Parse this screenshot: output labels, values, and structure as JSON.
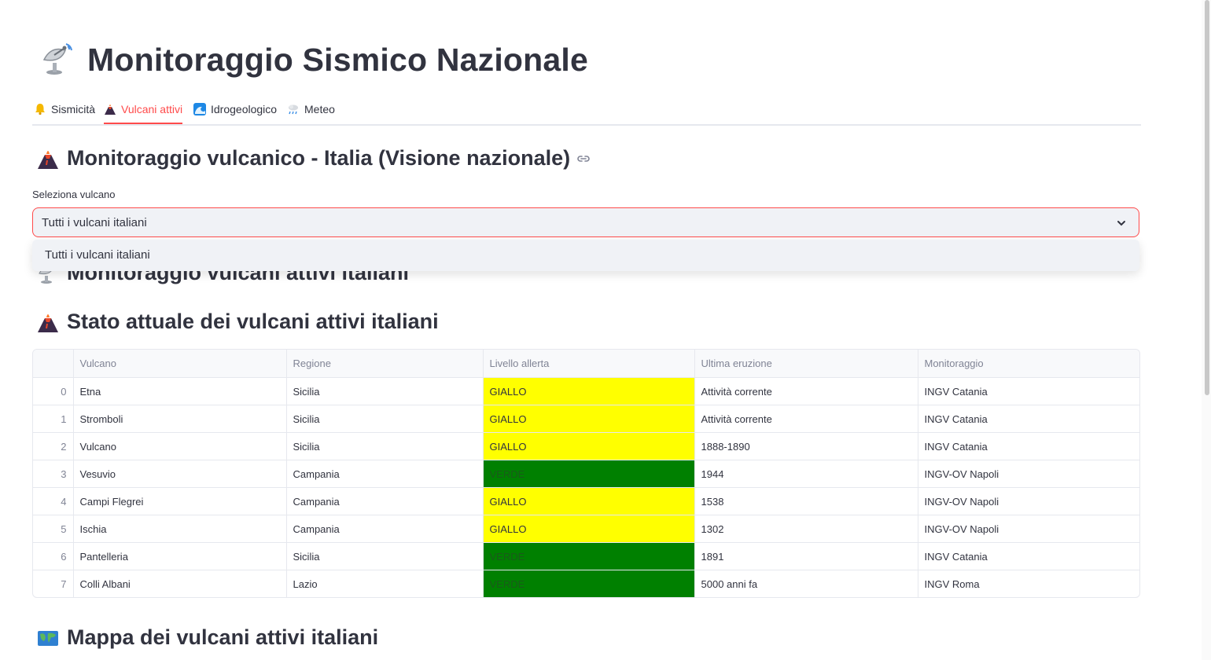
{
  "page": {
    "title": "Monitoraggio Sismico Nazionale",
    "title_icon": "satellite-antenna-icon"
  },
  "tabs": [
    {
      "label": "Sismicità",
      "icon": "bell-icon",
      "active": false
    },
    {
      "label": "Vulcani attivi",
      "icon": "volcano-icon",
      "active": true
    },
    {
      "label": "Idrogeologico",
      "icon": "water-wave-icon",
      "active": false
    },
    {
      "label": "Meteo",
      "icon": "rain-cloud-icon",
      "active": false
    }
  ],
  "section_main": {
    "title": "Monitoraggio vulcanico - Italia (Visione nazionale)",
    "icon": "volcano-icon",
    "link_icon": "link-icon"
  },
  "select": {
    "label": "Seleziona vulcano",
    "value": "Tutti i vulcani italiani",
    "options": [
      "Tutti i vulcani italiani"
    ]
  },
  "section_monitor": {
    "title": "Monitoraggio vulcani attivi italiani",
    "icon": "satellite-antenna-icon"
  },
  "section_status": {
    "title": "Stato attuale dei vulcani attivi italiani",
    "icon": "volcano-icon"
  },
  "table": {
    "columns": [
      "",
      "Vulcano",
      "Regione",
      "Livello allerta",
      "Ultima eruzione",
      "Monitoraggio"
    ],
    "rows": [
      [
        "0",
        "Etna",
        "Sicilia",
        "GIALLO",
        "Attività corrente",
        "INGV Catania"
      ],
      [
        "1",
        "Stromboli",
        "Sicilia",
        "GIALLO",
        "Attività corrente",
        "INGV Catania"
      ],
      [
        "2",
        "Vulcano",
        "Sicilia",
        "GIALLO",
        "1888-1890",
        "INGV Catania"
      ],
      [
        "3",
        "Vesuvio",
        "Campania",
        "VERDE",
        "1944",
        "INGV-OV Napoli"
      ],
      [
        "4",
        "Campi Flegrei",
        "Campania",
        "GIALLO",
        "1538",
        "INGV-OV Napoli"
      ],
      [
        "5",
        "Ischia",
        "Campania",
        "GIALLO",
        "1302",
        "INGV-OV Napoli"
      ],
      [
        "6",
        "Pantelleria",
        "Sicilia",
        "VERDE",
        "1891",
        "INGV Catania"
      ],
      [
        "7",
        "Colli Albani",
        "Lazio",
        "VERDE",
        "5000 anni fa",
        "INGV Roma"
      ]
    ],
    "level_colors": {
      "GIALLO": "#ffff00",
      "VERDE": "#008000"
    }
  },
  "section_map": {
    "title": "Mappa dei vulcani attivi italiani",
    "icon": "world-map-icon"
  },
  "colors": {
    "accent": "#ff4b4b",
    "text": "#31333f",
    "muted": "#808495",
    "select_bg": "#f0f2f6"
  }
}
